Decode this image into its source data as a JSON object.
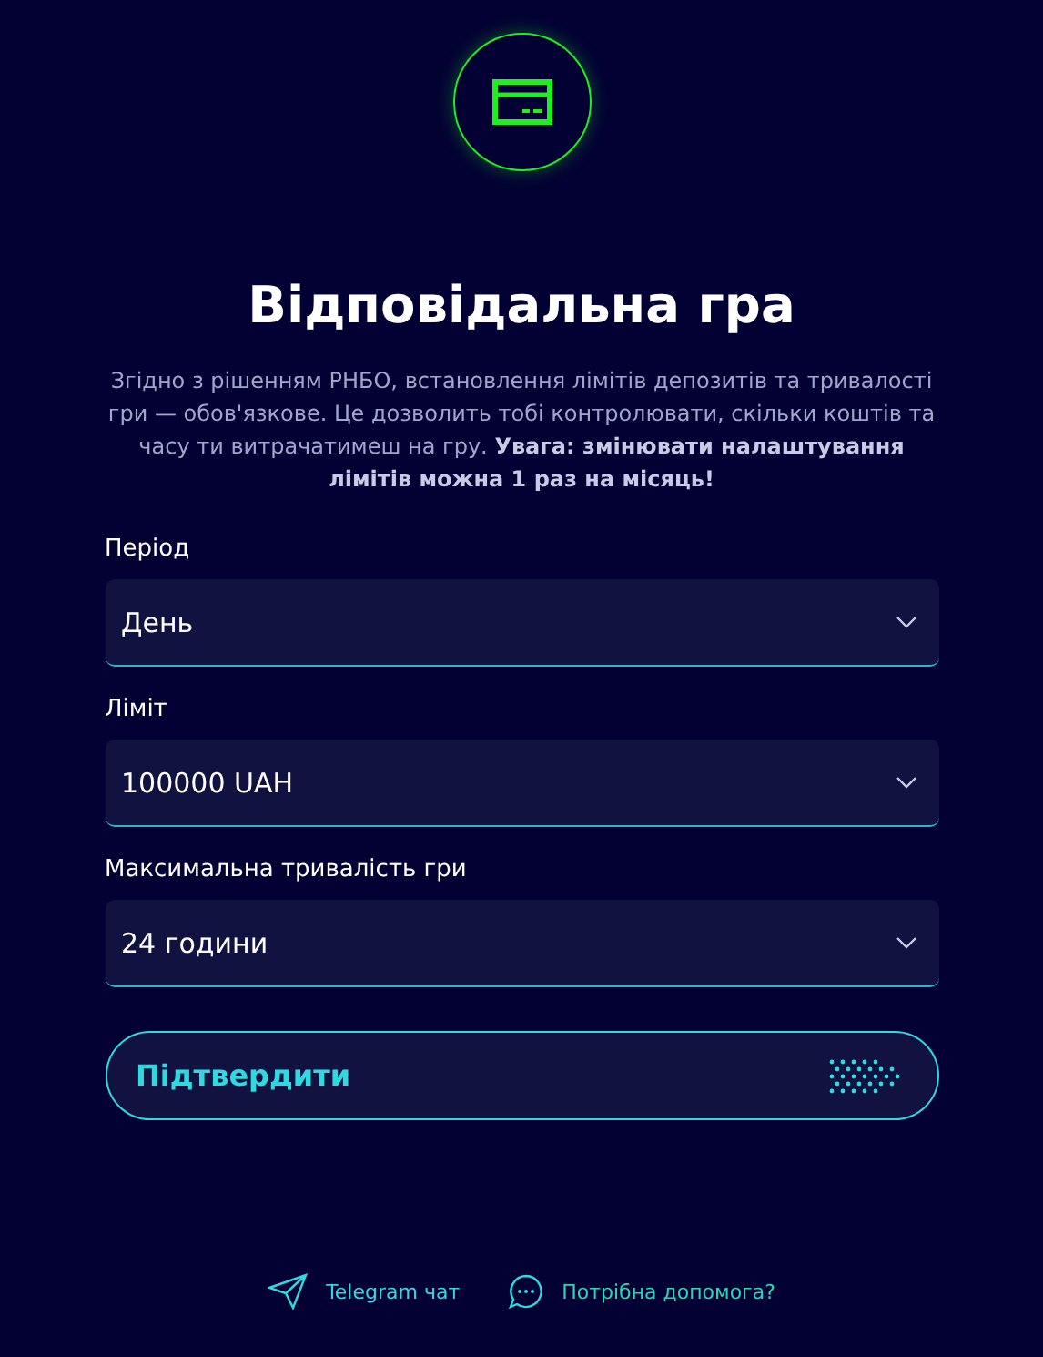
{
  "title": "Відповідальна гра",
  "description": "Згідно з рішенням РНБО, встановлення лімітів депозитів та тривалості гри — обов'язкове. Це дозволить тобі контролювати, скільки коштів та часу ти витрачатимеш на гру. **Увага: змінювати налаштування лімітів можна 1 раз на місяць!**",
  "fields": [
    {
      "label": "Період",
      "value": "День"
    },
    {
      "label": "Ліміт",
      "value": "100000 UAH"
    },
    {
      "label": "Максимальна тривалість гри",
      "value": "24 години"
    }
  ],
  "confirm_button": "Підтвердити",
  "footer_links": [
    {
      "kind": "telegram",
      "label": "Telegram чат"
    },
    {
      "kind": "help",
      "label": "Потрібна допомога?"
    }
  ]
}
